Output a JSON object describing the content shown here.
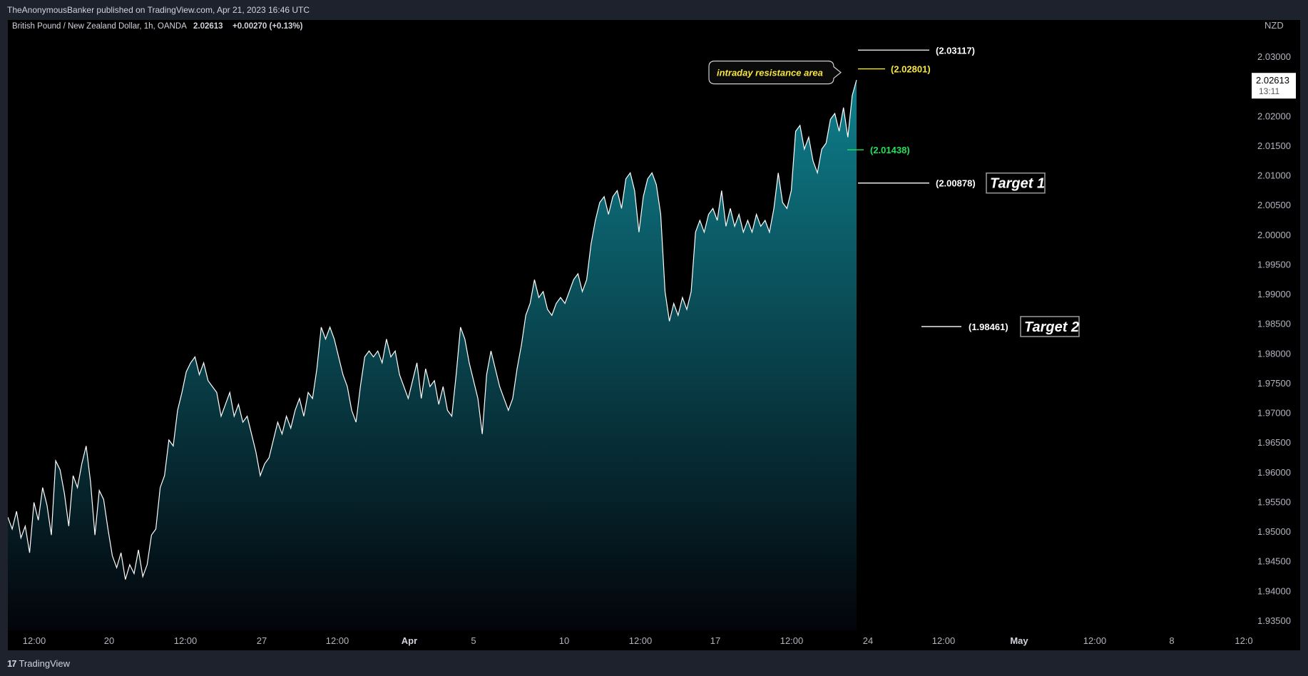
{
  "header": {
    "publish_line": "TheAnonymousBanker published on TradingView.com, Apr 21, 2023 16:46 UTC"
  },
  "footer": {
    "logo_glyph": "17",
    "brand": "TradingView"
  },
  "legend": {
    "symbol": "British Pound / New Zealand Dollar, 1h, OANDA",
    "last": "2.02613",
    "change": "+0.00270 (+0.13%)"
  },
  "colors": {
    "background": "#000000",
    "line": "#ffffff",
    "area_top": "#0e7f8c",
    "area_bottom": "#03040a",
    "white_level": "#ffffff",
    "yellow_level": "#f5e642",
    "green_level": "#22e05a"
  },
  "chart_data": {
    "type": "area",
    "currency": "NZD",
    "ylim": [
      1.9325,
      2.0335
    ],
    "y_ticks": [
      "2.03000",
      "2.02500",
      "2.02000",
      "2.01500",
      "2.01000",
      "2.00500",
      "2.00000",
      "1.99500",
      "1.99000",
      "1.98500",
      "1.98000",
      "1.97500",
      "1.97000",
      "1.96500",
      "1.96000",
      "1.95500",
      "1.95000",
      "1.94500",
      "1.94000",
      "1.93500"
    ],
    "x_ticks": [
      {
        "label": "12:00",
        "bold": false
      },
      {
        "label": "20",
        "bold": false
      },
      {
        "label": "12:00",
        "bold": false
      },
      {
        "label": "27",
        "bold": false
      },
      {
        "label": "12:00",
        "bold": false
      },
      {
        "label": "Apr",
        "bold": true
      },
      {
        "label": "5",
        "bold": false
      },
      {
        "label": "10",
        "bold": false
      },
      {
        "label": "12:00",
        "bold": false
      },
      {
        "label": "17",
        "bold": false
      },
      {
        "label": "12:00",
        "bold": false
      },
      {
        "label": "24",
        "bold": false
      },
      {
        "label": "12:00",
        "bold": false
      },
      {
        "label": "May",
        "bold": true
      },
      {
        "label": "12:00",
        "bold": false
      },
      {
        "label": "8",
        "bold": false
      },
      {
        "label": "12:0",
        "bold": false
      }
    ],
    "last_price": "2.02613",
    "countdown": "13:11",
    "levels": [
      {
        "label": "(2.03117)",
        "value": 2.03117,
        "color": "white"
      },
      {
        "label": "(2.02801)",
        "value": 2.02801,
        "color": "yellow"
      },
      {
        "label": "(2.01438)",
        "value": 2.01438,
        "color": "green"
      },
      {
        "label": "(2.00878)",
        "value": 2.00878,
        "color": "white"
      },
      {
        "label": "(1.98461)",
        "value": 1.98461,
        "color": "white"
      }
    ],
    "targets": [
      {
        "text": "Target 1",
        "value": 2.00878
      },
      {
        "text": "Target 2",
        "value": 1.98461
      }
    ],
    "annotation": {
      "text": "intraday resistance area",
      "value": 2.028
    },
    "series": [
      {
        "name": "",
        "values": [
          1.9525,
          1.9505,
          1.9535,
          1.949,
          1.951,
          1.9465,
          1.955,
          1.952,
          1.9575,
          1.9545,
          1.9495,
          1.962,
          1.9605,
          1.9565,
          1.951,
          1.9595,
          1.9575,
          1.9615,
          1.9645,
          1.9585,
          1.9495,
          1.957,
          1.9555,
          1.9505,
          1.946,
          1.944,
          1.9465,
          1.942,
          1.9445,
          1.943,
          1.947,
          1.9425,
          1.9445,
          1.9495,
          1.9505,
          1.9575,
          1.9595,
          1.9655,
          1.9645,
          1.9705,
          1.9735,
          1.977,
          1.9785,
          1.9795,
          1.9765,
          1.9785,
          1.9755,
          1.9745,
          1.9735,
          1.9695,
          1.9715,
          1.9735,
          1.9695,
          1.9715,
          1.9685,
          1.9695,
          1.9665,
          1.9635,
          1.9595,
          1.9615,
          1.9625,
          1.9655,
          1.9685,
          1.9665,
          1.9695,
          1.9675,
          1.9705,
          1.9725,
          1.9695,
          1.9735,
          1.9725,
          1.9775,
          1.9845,
          1.9825,
          1.9845,
          1.9825,
          1.9795,
          1.9765,
          1.9745,
          1.9705,
          1.9685,
          1.9745,
          1.9795,
          1.9805,
          1.9795,
          1.9805,
          1.9785,
          1.9825,
          1.9795,
          1.9805,
          1.9765,
          1.9745,
          1.9725,
          1.9755,
          1.9785,
          1.9725,
          1.9775,
          1.9745,
          1.9755,
          1.9715,
          1.9745,
          1.9705,
          1.9695,
          1.9765,
          1.9845,
          1.9825,
          1.9785,
          1.9755,
          1.9725,
          1.9665,
          1.9765,
          1.9805,
          1.9775,
          1.9745,
          1.9725,
          1.9705,
          1.9725,
          1.9775,
          1.9815,
          1.9865,
          1.9885,
          1.9925,
          1.9895,
          1.9905,
          1.9875,
          1.9865,
          1.9885,
          1.9895,
          1.9885,
          1.9905,
          1.9925,
          1.9935,
          1.9905,
          1.9925,
          1.9985,
          2.0025,
          2.0055,
          2.0065,
          2.0035,
          2.0065,
          2.0075,
          2.0045,
          2.0095,
          2.0105,
          2.0075,
          2.0005,
          2.0065,
          2.0095,
          2.0105,
          2.0085,
          2.0035,
          1.9905,
          1.9855,
          1.9885,
          1.9865,
          1.9895,
          1.9875,
          1.9905,
          2.0005,
          2.0025,
          2.0005,
          2.0035,
          2.0045,
          2.0025,
          2.0075,
          2.0015,
          2.0045,
          2.0015,
          2.0035,
          2.0005,
          2.0025,
          2.0005,
          2.0035,
          2.0015,
          2.0025,
          2.0005,
          2.0045,
          2.0105,
          2.0055,
          2.0045,
          2.0075,
          2.0175,
          2.0185,
          2.0145,
          2.0165,
          2.0125,
          2.0105,
          2.0145,
          2.0155,
          2.0195,
          2.0205,
          2.0175,
          2.0215,
          2.0165,
          2.0235,
          2.02613
        ]
      }
    ]
  }
}
